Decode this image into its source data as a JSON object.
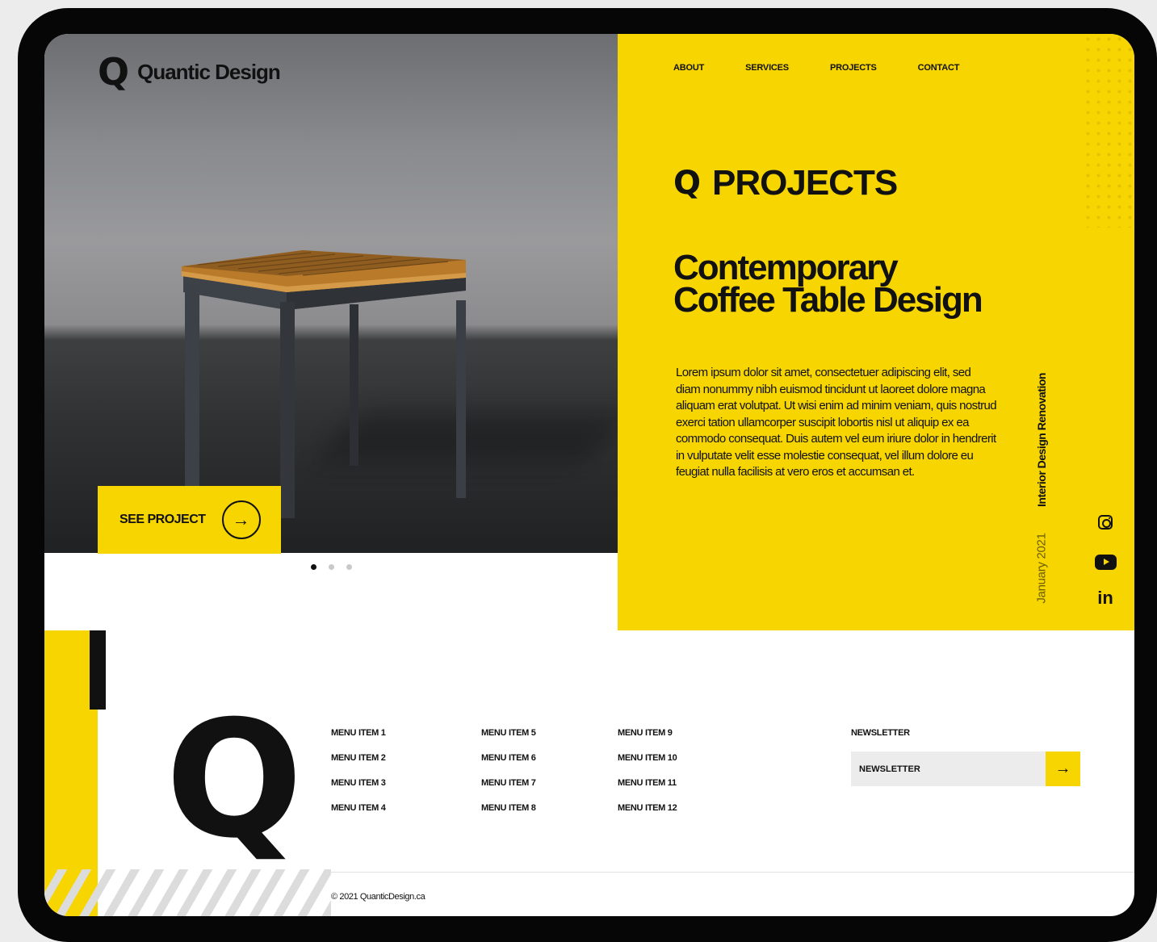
{
  "brand": {
    "name": "Quantic Design",
    "logo_glyph": "Q"
  },
  "nav": {
    "items": [
      "ABOUT",
      "SERVICES",
      "PROJECTS",
      "CONTACT"
    ]
  },
  "hero": {
    "cta_label": "SEE PROJECT",
    "cta_arrow": "→",
    "slides_count": 3,
    "active_slide": 1
  },
  "projects": {
    "section_title": "PROJECTS",
    "headline_line1": "Contemporary",
    "headline_line2": "Coffee Table Design",
    "body": "Lorem ipsum dolor sit amet, consectetuer adipiscing elit, sed diam nonummy nibh euismod tincidunt ut laoreet dolore magna aliquam erat volutpat. Ut wisi enim ad minim veniam, quis nostrud exerci tation ullamcorper suscipit lobortis nisl ut aliquip ex ea commodo consequat. Duis autem vel eum iriure dolor in hendrerit in vulputate velit esse molestie consequat, vel illum dolore eu feugiat nulla facilisis at vero eros et accumsan et.",
    "category": "Interior Design Renovation",
    "date": "January 2021"
  },
  "social": {
    "icons": [
      "instagram-icon",
      "youtube-icon",
      "linkedin-icon"
    ],
    "linkedin_text": "in"
  },
  "footer": {
    "menu_col1": [
      "MENU ITEM 1",
      "MENU ITEM 2",
      "MENU ITEM 3",
      "MENU ITEM 4"
    ],
    "menu_col2": [
      "MENU ITEM 5",
      "MENU ITEM 6",
      "MENU ITEM 7",
      "MENU ITEM 8"
    ],
    "menu_col3": [
      "MENU ITEM 9",
      "MENU ITEM 10",
      "MENU ITEM 11",
      "MENU ITEM 12"
    ],
    "newsletter_title": "NEWSLETTER",
    "newsletter_placeholder": "NEWSLETTER",
    "newsletter_arrow": "→",
    "copyright": "© 2021 QuanticDesign.ca"
  },
  "colors": {
    "accent": "#f7d500",
    "dark": "#111111",
    "frame": "#060606"
  }
}
